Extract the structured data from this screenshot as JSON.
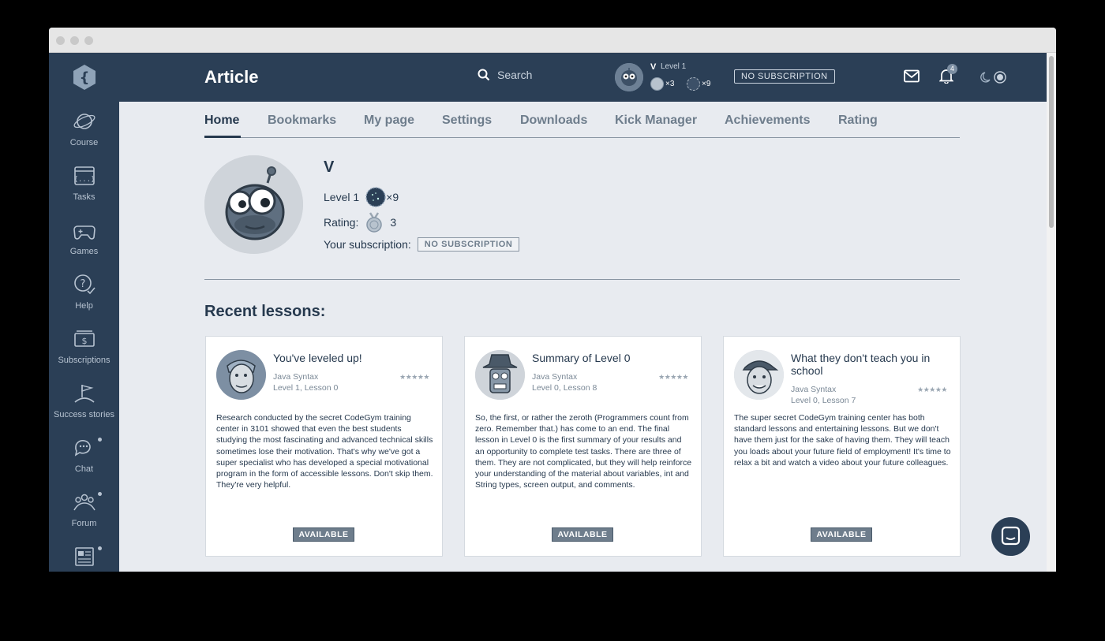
{
  "header": {
    "title": "Article",
    "search_placeholder": "Search",
    "user": {
      "name": "V",
      "level": "Level 1",
      "medal_a_count": "×3",
      "medal_b_count": "×9"
    },
    "subscription_label": "NO SUBSCRIPTION",
    "notification_count": "4"
  },
  "sidebar": {
    "items": [
      {
        "label": "Course"
      },
      {
        "label": "Tasks"
      },
      {
        "label": "Games"
      },
      {
        "label": "Help"
      },
      {
        "label": "Subscriptions"
      },
      {
        "label": "Success stories"
      },
      {
        "label": "Chat"
      },
      {
        "label": "Forum"
      }
    ]
  },
  "tabs": [
    {
      "label": "Home"
    },
    {
      "label": "Bookmarks"
    },
    {
      "label": "My page"
    },
    {
      "label": "Settings"
    },
    {
      "label": "Downloads"
    },
    {
      "label": "Kick Manager"
    },
    {
      "label": "Achievements"
    },
    {
      "label": "Rating"
    }
  ],
  "profile": {
    "name": "V",
    "level_label": "Level 1",
    "level_medals": "×9",
    "rating_label": "Rating:",
    "rating_value": "3",
    "subscription_label": "Your subscription:",
    "subscription_value": "NO SUBSCRIPTION"
  },
  "recent": {
    "title": "Recent lessons:",
    "lessons": [
      {
        "title": "You've leveled up!",
        "quest": "Java Syntax",
        "lesson": "Level 1, Lesson 0",
        "stars": "★★★★★",
        "description": "Research conducted by the secret CodeGym training center in 3101 showed that even the best students studying the most fascinating and advanced technical skills sometimes lose their motivation. That's why we've got a super specialist who has developed a special motivational program in the form of accessible lessons. Don't skip them. They're very helpful.",
        "status": "AVAILABLE"
      },
      {
        "title": "Summary of Level 0",
        "quest": "Java Syntax",
        "lesson": "Level 0, Lesson 8",
        "stars": "★★★★★",
        "description": "So, the first, or rather the zeroth (Programmers count from zero. Remember that.) has come to an end. The final lesson in Level 0 is the first summary of your results and an opportunity to complete test tasks. There are three of them. They are not complicated, but they will help reinforce your understanding of the material about variables, int and String types, screen output, and comments.",
        "status": "AVAILABLE"
      },
      {
        "title": "What they don't teach you in school",
        "quest": "Java Syntax",
        "lesson": "Level 0, Lesson 7",
        "stars": "★★★★★",
        "description": "The super secret CodeGym training center has both standard lessons and entertaining lessons. But we don't have them just for the sake of having them. They will teach you loads about your future field of employment! It's time to relax a bit and watch a video about your future colleagues.",
        "status": "AVAILABLE"
      }
    ]
  },
  "colors": {
    "nav_bg": "#2b3f56",
    "page_bg": "#e8ebf0",
    "text_dark": "#26394e",
    "text_muted": "#6e7d8c"
  }
}
